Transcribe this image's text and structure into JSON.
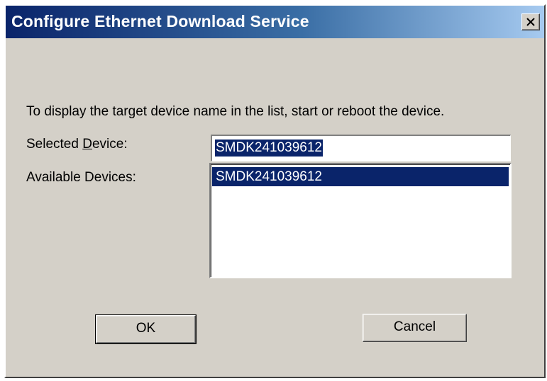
{
  "window": {
    "title": "Configure Ethernet Download Service",
    "close_icon": "close-icon"
  },
  "instruction": "To display the target device name in the list, start or reboot the device.",
  "selected_device": {
    "label_prefix": "Selected ",
    "label_mnemonic": "D",
    "label_suffix": "evice:",
    "value": "SMDK241039612"
  },
  "available_devices": {
    "label": "Available Devices:",
    "items": [
      "SMDK241039612"
    ],
    "selected_index": 0
  },
  "buttons": {
    "ok_label": "OK",
    "cancel_label": "Cancel"
  },
  "colors": {
    "title_gradient_start": "#0a246a",
    "title_gradient_end": "#a6caf0",
    "selection_background": "#0a246a",
    "dialog_face": "#d4d0c8"
  }
}
